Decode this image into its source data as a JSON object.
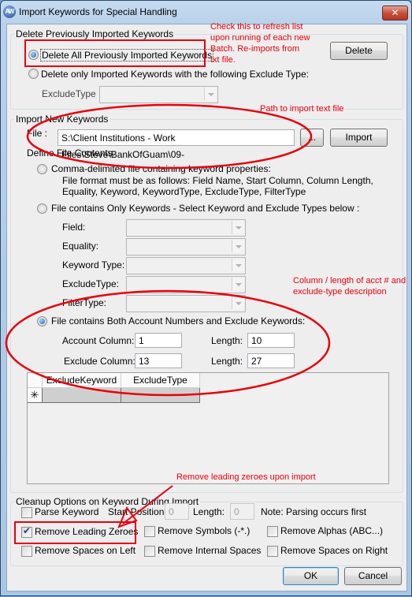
{
  "window": {
    "title": "Import Keywords for Special Handling",
    "app_icon_text": "AW",
    "close_glyph": "✕"
  },
  "delete_group": {
    "title": "Delete Previously Imported Keywords",
    "option_all": {
      "label": "Delete All Previously Imported Keywords",
      "selected": true
    },
    "option_by_type": {
      "label": "Delete only Imported Keywords with the following Exclude Type:",
      "selected": false
    },
    "exclude_type_label": "ExcludeType :",
    "exclude_type_value": "",
    "delete_button": "Delete"
  },
  "import_group": {
    "title": "Import New Keywords",
    "file_label": "File :",
    "file_path": "S:\\Client Institutions - Work Files\\Steve\\BankOfGuam\\09-",
    "browse_button": "...",
    "import_button": "Import",
    "define_label": "Define File Contents:",
    "option_comma": {
      "label": "Comma-delimited file containing keyword properties:",
      "selected": false,
      "desc_line1": "File format must be as follows: Field Name, Start Column, Column Length,",
      "desc_line2": "Equality, Keyword, KeywordType, ExcludeType,  FilterType"
    },
    "option_keywords_only": {
      "label": "File contains Only Keywords - Select Keyword and Exclude Types below :",
      "selected": false
    },
    "combos": [
      {
        "label": "Field:",
        "value": ""
      },
      {
        "label": "Equality:",
        "value": ""
      },
      {
        "label": "Keyword Type:",
        "value": ""
      },
      {
        "label": "ExcludeType:",
        "value": ""
      },
      {
        "label": "FilterType:",
        "value": ""
      }
    ],
    "option_both": {
      "label": "File contains Both Account Numbers and Exclude Keywords:",
      "selected": true
    },
    "account_column_label": "Account Column:",
    "account_column_value": "1",
    "account_length_label": "Length:",
    "account_length_value": "10",
    "exclude_column_label": "Exclude Column:",
    "exclude_column_value": "13",
    "exclude_length_label": "Length:",
    "exclude_length_value": "27",
    "grid": {
      "columns": [
        "ExcludeKeyword",
        "ExcludeType"
      ],
      "new_row_marker": "✳"
    }
  },
  "cleanup_group": {
    "title": "Cleanup Options on Keyword During Import",
    "parse_keyword": {
      "label": "Parse Keyword",
      "checked": false
    },
    "start_position_label": "Start Position:",
    "start_position_value": "0",
    "length_label": "Length:",
    "length_value": "0",
    "note": "Note: Parsing occurs first",
    "options": [
      {
        "label": "Remove Leading Zeroes",
        "checked": true
      },
      {
        "label": "Remove Symbols (-*.)",
        "checked": false
      },
      {
        "label": "Remove Alphas (ABC...)",
        "checked": false
      },
      {
        "label": "Remove Spaces on Left",
        "checked": false
      },
      {
        "label": "Remove Internal Spaces",
        "checked": false
      },
      {
        "label": "Remove Spaces on Right",
        "checked": false
      }
    ]
  },
  "footer": {
    "ok_button": "OK",
    "cancel_button": "Cancel"
  },
  "annotations": {
    "refresh_note": [
      "Check this to refresh list",
      "upon running of each new",
      "Batch. Re-imports from",
      "txt file."
    ],
    "path_note": "Path to import text file",
    "column_note": [
      "Column / length of acct # and",
      "exclude-type description"
    ],
    "zeroes_note": "Remove leading zeroes upon import",
    "annotation_color": "#e8000b"
  }
}
